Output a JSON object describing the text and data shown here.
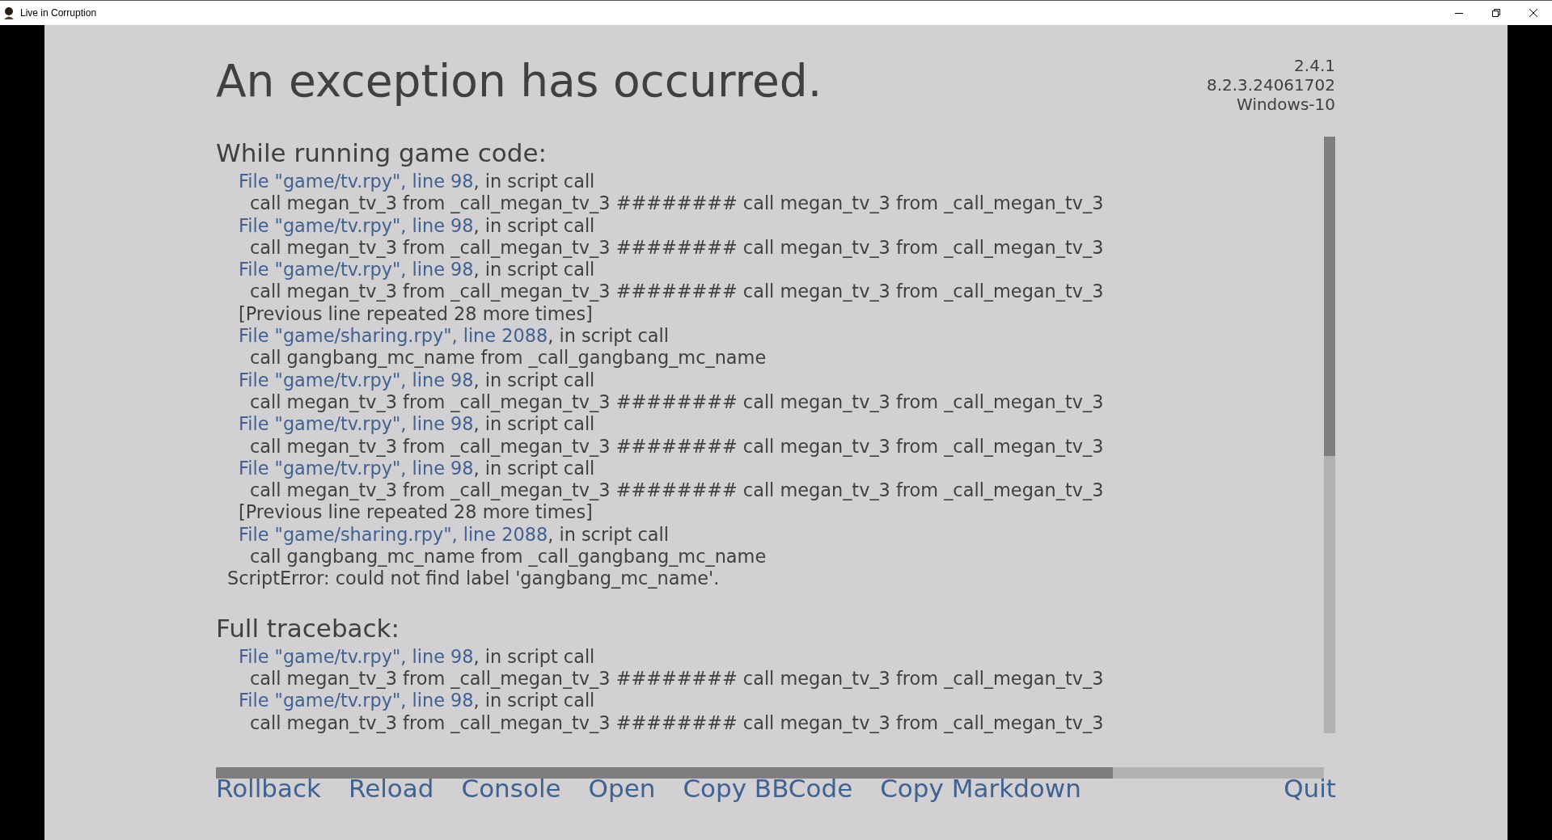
{
  "window": {
    "title": "Live in Corruption"
  },
  "heading": "An exception has occurred.",
  "version_info": [
    "2.4.1",
    "8.2.3.24061702",
    "Windows-10"
  ],
  "sections": [
    {
      "heading": "While running game code:",
      "lines": [
        {
          "kind": "file",
          "link": "File \"game/tv.rpy\", line 98",
          "rest": ", in script call"
        },
        {
          "kind": "code",
          "text": "call megan_tv_3 from _call_megan_tv_3 ######## call megan_tv_3 from _call_megan_tv_3"
        },
        {
          "kind": "file",
          "link": "File \"game/tv.rpy\", line 98",
          "rest": ", in script call"
        },
        {
          "kind": "code",
          "text": "call megan_tv_3 from _call_megan_tv_3 ######## call megan_tv_3 from _call_megan_tv_3"
        },
        {
          "kind": "file",
          "link": "File \"game/tv.rpy\", line 98",
          "rest": ", in script call"
        },
        {
          "kind": "code",
          "text": "call megan_tv_3 from _call_megan_tv_3 ######## call megan_tv_3 from _call_megan_tv_3"
        },
        {
          "kind": "note",
          "text": "[Previous line repeated 28 more times]"
        },
        {
          "kind": "file",
          "link": "File \"game/sharing.rpy\", line 2088",
          "rest": ", in script call"
        },
        {
          "kind": "code",
          "text": "call gangbang_mc_name from _call_gangbang_mc_name"
        },
        {
          "kind": "file",
          "link": "File \"game/tv.rpy\", line 98",
          "rest": ", in script call"
        },
        {
          "kind": "code",
          "text": "call megan_tv_3 from _call_megan_tv_3 ######## call megan_tv_3 from _call_megan_tv_3"
        },
        {
          "kind": "file",
          "link": "File \"game/tv.rpy\", line 98",
          "rest": ", in script call"
        },
        {
          "kind": "code",
          "text": "call megan_tv_3 from _call_megan_tv_3 ######## call megan_tv_3 from _call_megan_tv_3"
        },
        {
          "kind": "file",
          "link": "File \"game/tv.rpy\", line 98",
          "rest": ", in script call"
        },
        {
          "kind": "code",
          "text": "call megan_tv_3 from _call_megan_tv_3 ######## call megan_tv_3 from _call_megan_tv_3"
        },
        {
          "kind": "note",
          "text": "[Previous line repeated 28 more times]"
        },
        {
          "kind": "file",
          "link": "File \"game/sharing.rpy\", line 2088",
          "rest": ", in script call"
        },
        {
          "kind": "code",
          "text": "call gangbang_mc_name from _call_gangbang_mc_name"
        },
        {
          "kind": "error",
          "text": "ScriptError: could not find label 'gangbang_mc_name'."
        }
      ]
    },
    {
      "heading": "Full traceback:",
      "lines": [
        {
          "kind": "file",
          "link": "File \"game/tv.rpy\", line 98",
          "rest": ", in script call"
        },
        {
          "kind": "code",
          "text": "call megan_tv_3 from _call_megan_tv_3 ######## call megan_tv_3 from _call_megan_tv_3"
        },
        {
          "kind": "file",
          "link": "File \"game/tv.rpy\", line 98",
          "rest": ", in script call"
        },
        {
          "kind": "code",
          "text": "call megan_tv_3 from _call_megan_tv_3 ######## call megan_tv_3 from _call_megan_tv_3"
        }
      ]
    }
  ],
  "actions": [
    {
      "label": "Rollback"
    },
    {
      "label": "Reload"
    },
    {
      "label": "Console"
    },
    {
      "label": "Open"
    },
    {
      "label": "Copy BBCode"
    },
    {
      "label": "Copy Markdown"
    }
  ],
  "quit": {
    "label": "Quit"
  }
}
